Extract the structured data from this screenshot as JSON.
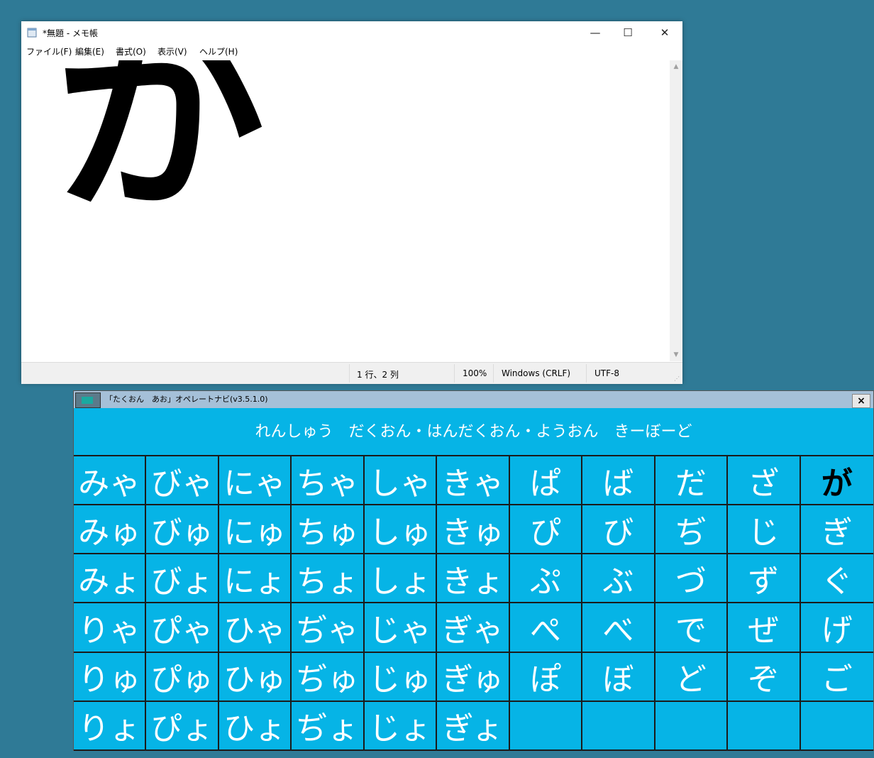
{
  "notepad": {
    "title": "*無題 - メモ帳",
    "minimize": "—",
    "maximize": "☐",
    "close": "✕",
    "menu": [
      "ファイル(F)",
      "編集(E)",
      "書式(O)",
      "表示(V)",
      "ヘルプ(H)"
    ],
    "content": "が",
    "status": {
      "position": "1 行、2 列",
      "zoom": "100%",
      "line_ending": "Windows (CRLF)",
      "encoding": "UTF-8"
    }
  },
  "keyboard": {
    "title": "「たくおん　あお」オペレートナビ(v3.5.1.0)",
    "close": "×",
    "header": "れんしゅう　だくおん・はんだくおん・ようおん　きーぼーど",
    "selected_key": "が",
    "rows": [
      [
        "みゃ",
        "びゃ",
        "にゃ",
        "ちゃ",
        "しゃ",
        "きゃ",
        "ぱ",
        "ば",
        "だ",
        "ざ",
        "が"
      ],
      [
        "みゅ",
        "びゅ",
        "にゅ",
        "ちゅ",
        "しゅ",
        "きゅ",
        "ぴ",
        "び",
        "ぢ",
        "じ",
        "ぎ"
      ],
      [
        "みょ",
        "びょ",
        "にょ",
        "ちょ",
        "しょ",
        "きょ",
        "ぷ",
        "ぶ",
        "づ",
        "ず",
        "ぐ"
      ],
      [
        "りゃ",
        "ぴゃ",
        "ひゃ",
        "ぢゃ",
        "じゃ",
        "ぎゃ",
        "ぺ",
        "べ",
        "で",
        "ぜ",
        "げ"
      ],
      [
        "りゅ",
        "ぴゅ",
        "ひゅ",
        "ぢゅ",
        "じゅ",
        "ぎゅ",
        "ぽ",
        "ぼ",
        "ど",
        "ぞ",
        "ご"
      ],
      [
        "りょ",
        "ぴょ",
        "ひょ",
        "ぢょ",
        "じょ",
        "ぎょ",
        "",
        "",
        "",
        "",
        ""
      ]
    ]
  }
}
